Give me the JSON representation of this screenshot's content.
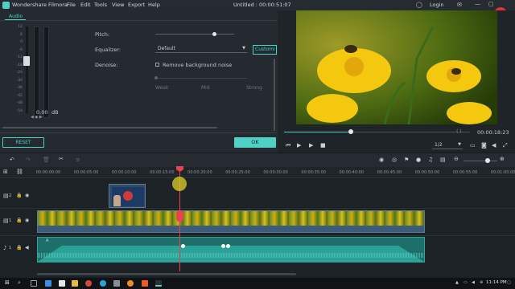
{
  "app": {
    "name": "Wondershare Filmora",
    "menu": [
      "File",
      "Edit",
      "Tools",
      "View",
      "Export",
      "Help"
    ],
    "project_title": "Untitled : 00:00:51:07",
    "login_label": "Login"
  },
  "editor": {
    "tab_audio": "Audio",
    "meter_scale": [
      "12",
      "6",
      "0",
      "-6",
      "-12",
      "-18",
      "-24",
      "-30",
      "-36",
      "-42",
      "-48",
      "-54"
    ],
    "volume_value": "0.00",
    "volume_unit": "dB",
    "pitch_label": "Pitch:",
    "pitch_level": 0.75,
    "equalizer_label": "Equalizer:",
    "equalizer_value": "Default",
    "customize_label": "Customi",
    "denoise_label": "Denoise:",
    "remove_noise_label": "Remove background noise",
    "denoise_levels": [
      "Weak",
      "Mid",
      "Strong"
    ],
    "reset_label": "RESET",
    "ok_label": "OK"
  },
  "preview": {
    "timecode": "00:00:18:23",
    "playhead_fraction": 0.36,
    "quality": "1/2"
  },
  "timeline": {
    "ruler_labels": [
      "00:00:00:00",
      "00:00:05:00",
      "00:00:10:00",
      "00:00:15:00",
      "00:00:20:00",
      "00:00:25:00",
      "00:00:30:00",
      "00:00:35:00",
      "00:00:40:00",
      "00:00:45:00",
      "00:00:50:00",
      "00:00:55:00",
      "00:01:00:00"
    ],
    "track_labels": [
      "2",
      "1",
      "1"
    ],
    "audio_clip_label": "A"
  },
  "taskbar": {
    "time": "11:14 PM"
  },
  "colors": {
    "accent": "#4fd1c5",
    "playhead": "#e8434f",
    "video_clip": "#2f4a63",
    "audio_clip": "#1f8c83"
  }
}
